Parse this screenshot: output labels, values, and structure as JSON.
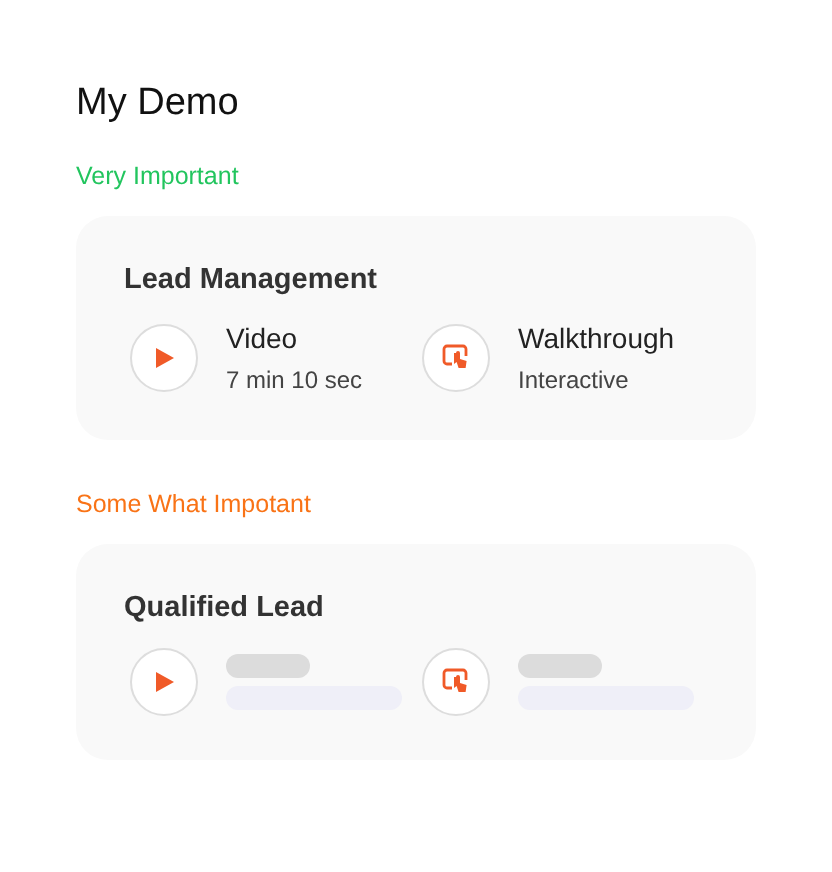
{
  "title": "My Demo",
  "groups": [
    {
      "label": "Very Important",
      "color": "#22c55e",
      "cards": [
        {
          "title": "Lead Management",
          "items": [
            {
              "kind": "video",
              "loading": false,
              "name": "Video",
              "detail": "7 min 10 sec"
            },
            {
              "kind": "walkthrough",
              "loading": false,
              "name": "Walkthrough",
              "detail": "Interactive"
            }
          ]
        }
      ]
    },
    {
      "label": "Some What Impotant",
      "color": "#f97316",
      "cards": [
        {
          "title": "Qualified Lead",
          "items": [
            {
              "kind": "video",
              "loading": true
            },
            {
              "kind": "walkthrough",
              "loading": true
            }
          ]
        }
      ]
    }
  ]
}
